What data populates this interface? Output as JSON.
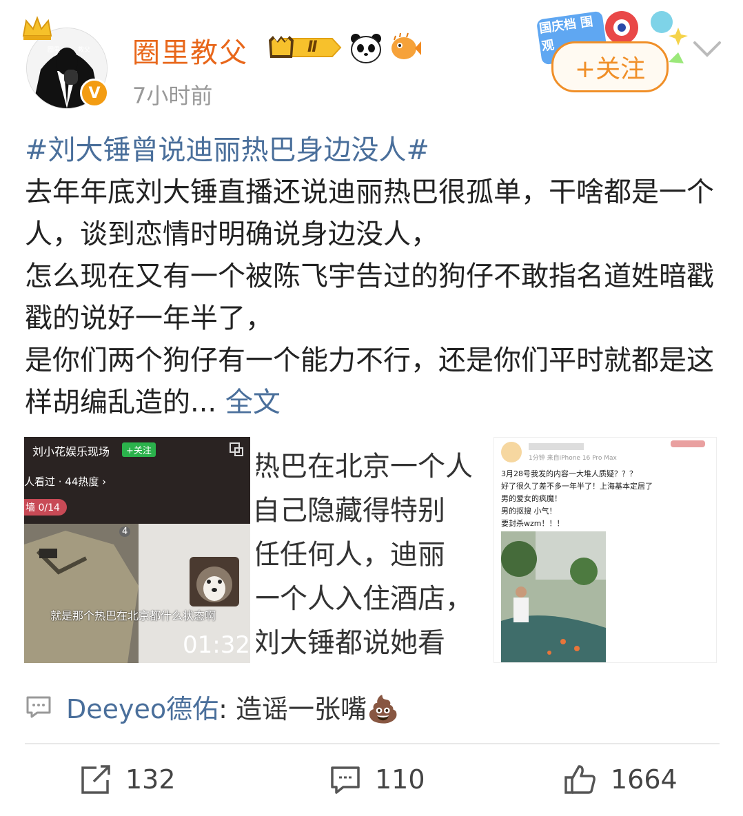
{
  "header": {
    "username": "圈里教父",
    "level_badge": "Ⅱ",
    "time": "7小时前",
    "follow_label": "+关注",
    "festival_badge": "国庆档 围观"
  },
  "avatar": {
    "top_text_left": "圈里",
    "top_text_right": "教父",
    "verified": "V"
  },
  "post": {
    "topic": "#刘大锤曾说迪丽热巴身边没人#",
    "body": "去年年底刘大锤直播还说迪丽热巴很孤单，干啥都是一个人，谈到恋情时明确说身边没人，\n怎么现在又有一个被陈飞宇告过的狗仔不敢指名道姓暗戳戳的说好一年半了，\n是你们两个狗仔有一个能力不行，还是你们平时就都是这样胡编乱造的...",
    "fulltext_link": "全文"
  },
  "image1": {
    "account": "刘小花娱乐现场",
    "follow": "+关注",
    "viewers": "人看过 · 44热度 ›",
    "wall": "墙 0/14",
    "count": "4",
    "subtitle": "就是那个热巴在北京都什么状态啊",
    "duration": "01:32"
  },
  "image2": {
    "lines": [
      "热巴在北京一个人",
      "自己隐藏得特别",
      "任任何人，迪丽",
      "一个人入住酒店，",
      "刘大锤都说她看"
    ]
  },
  "image3": {
    "meta": "1分钟  来自iPhone 16 Pro Max",
    "lines": [
      "3月28号我发的内容一大堆人质疑？？？",
      "好了很久了差不多一年半了！上海基本定居了",
      "男的爱女的疯魔！",
      "男的抠搜 小气！",
      "要封杀wzm！！！"
    ]
  },
  "repost": {
    "name": "Deeyeo德佑",
    "text": ": 造谣一张嘴💩"
  },
  "actions": {
    "share_count": "132",
    "comment_count": "110",
    "like_count": "1664"
  }
}
